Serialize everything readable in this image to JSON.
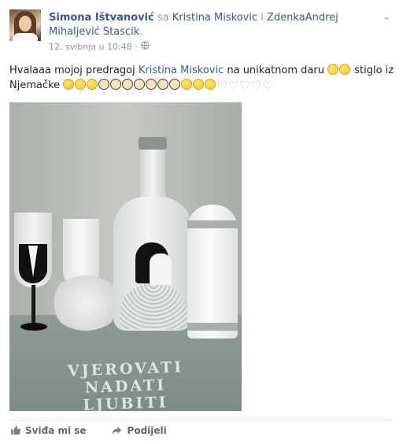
{
  "post": {
    "author": "Simona Ištvanović",
    "with_word": "sa",
    "tagged1": "Kristina Miskovic",
    "and_word": "i",
    "tagged2": "ZdenkaAndrej Mihaljević Stascik",
    "tail": ".",
    "timestamp": "12. svibnja u 10:48",
    "privacy_separator": "·",
    "privacy_icon": "globe-icon",
    "text_part1": "Hvalaaa mojoj predragoj",
    "text_mention": "Kristina Miskovic",
    "text_part2": "na unikatnom daru",
    "text_part3": "stiglo iz Njemačke",
    "photo_caption": [
      "VJEROVATI",
      "NADATI",
      "LJUBITI"
    ]
  },
  "actions": {
    "like": "Sviđa mi se",
    "share": "Podijeli"
  },
  "icons": {
    "menu": "chevron-down-icon",
    "like": "thumbs-up-icon",
    "share": "share-arrow-icon"
  },
  "colors": {
    "link": "#365899",
    "muted": "#90949c",
    "text": "#1d2129"
  }
}
